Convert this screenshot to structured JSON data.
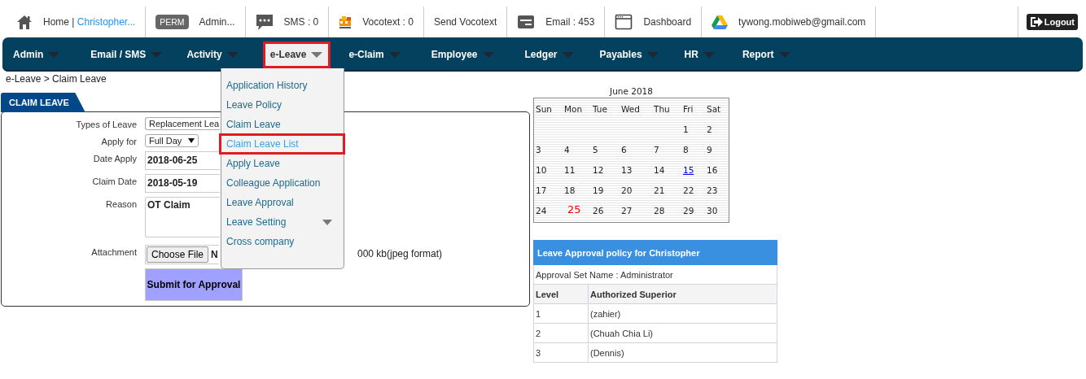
{
  "top_bar": {
    "items": [
      {
        "kind": "home",
        "label": "Home |",
        "link": "Christopher..."
      },
      {
        "kind": "perm",
        "badge": "PERM",
        "label": "Admin..."
      },
      {
        "kind": "sms",
        "label": "SMS : 0"
      },
      {
        "kind": "vocotext",
        "label": "Vocotext : 0"
      },
      {
        "kind": "text",
        "label": "Send Vocotext"
      },
      {
        "kind": "email",
        "label": "Email : 453"
      },
      {
        "kind": "dashboard",
        "label": "Dashboard"
      },
      {
        "kind": "drive",
        "label": "tywong.mobiweb@gmail.com"
      }
    ],
    "logout": "Logout"
  },
  "nav": {
    "items": [
      {
        "label": "Admin",
        "selected": false
      },
      {
        "label": "Email / SMS",
        "selected": false
      },
      {
        "label": "Activity",
        "selected": false
      },
      {
        "label": "e-Leave",
        "selected": true
      },
      {
        "label": "e-Claim",
        "selected": false
      },
      {
        "label": "Employee",
        "selected": false
      },
      {
        "label": "Ledger",
        "selected": false
      },
      {
        "label": "Payables",
        "selected": false
      },
      {
        "label": "HR",
        "selected": false
      },
      {
        "label": "Report",
        "selected": false
      }
    ]
  },
  "dropdown": {
    "items": [
      {
        "label": "Application History",
        "selected": false,
        "submenu": false
      },
      {
        "label": "Leave Policy",
        "selected": false,
        "submenu": false
      },
      {
        "label": "Claim Leave",
        "selected": false,
        "submenu": false
      },
      {
        "label": "Claim Leave List",
        "selected": true,
        "submenu": false
      },
      {
        "label": "Apply Leave",
        "selected": false,
        "submenu": false
      },
      {
        "label": "Colleague Application",
        "selected": false,
        "submenu": false
      },
      {
        "label": "Leave Approval",
        "selected": false,
        "submenu": false
      },
      {
        "label": "Leave Setting",
        "selected": false,
        "submenu": true
      },
      {
        "label": "Cross company",
        "selected": false,
        "submenu": false
      }
    ]
  },
  "breadcrumb": "e-Leave > Claim Leave",
  "form": {
    "tab": "CLAIM LEAVE",
    "fields": [
      {
        "kind": "select",
        "label": "Types of Leave",
        "value": "Replacement Lea"
      },
      {
        "kind": "dropdown",
        "label": "Apply for",
        "value": "Full Day"
      },
      {
        "kind": "input",
        "label": "Date Apply",
        "value": "2018-06-25"
      },
      {
        "kind": "input",
        "label": "Claim Date",
        "value": "2018-05-19"
      },
      {
        "kind": "textarea",
        "label": "Reason",
        "value": "OT Claim"
      },
      {
        "kind": "file",
        "label": "Attachment",
        "button": "Choose File",
        "value": "N",
        "note": "000 kb(jpeg format)"
      }
    ],
    "submit": "Submit for Approval"
  },
  "calendar": {
    "title": "June 2018",
    "weekdays": [
      "Sun",
      "Mon",
      "Tue",
      "Wed",
      "Thu",
      "Fri",
      "Sat"
    ],
    "weeks": [
      [
        {
          "text": "1",
          "kind": "plain"
        },
        {
          "text": "2",
          "kind": "plain"
        }
      ],
      [
        {
          "text": "3",
          "kind": "plain"
        },
        {
          "text": "4",
          "kind": "plain"
        },
        {
          "text": "5",
          "kind": "plain"
        },
        {
          "text": "6",
          "kind": "plain"
        },
        {
          "text": "7",
          "kind": "plain"
        },
        {
          "text": "8",
          "kind": "plain"
        },
        {
          "text": "9",
          "kind": "plain"
        }
      ],
      [
        {
          "text": "10",
          "kind": "plain"
        },
        {
          "text": "11",
          "kind": "plain"
        },
        {
          "text": "12",
          "kind": "plain"
        },
        {
          "text": "13",
          "kind": "plain"
        },
        {
          "text": "14",
          "kind": "plain"
        },
        {
          "text": "15",
          "kind": "link"
        },
        {
          "text": "16",
          "kind": "plain"
        }
      ],
      [
        {
          "text": "17",
          "kind": "plain"
        },
        {
          "text": "18",
          "kind": "plain"
        },
        {
          "text": "19",
          "kind": "plain"
        },
        {
          "text": "20",
          "kind": "plain"
        },
        {
          "text": "21",
          "kind": "plain"
        },
        {
          "text": "22",
          "kind": "plain"
        },
        {
          "text": "23",
          "kind": "plain"
        }
      ],
      [
        {
          "text": "24",
          "kind": "plain"
        },
        {
          "text": "25",
          "kind": "today"
        },
        {
          "text": "26",
          "kind": "plain"
        },
        {
          "text": "27",
          "kind": "plain"
        },
        {
          "text": "28",
          "kind": "plain"
        },
        {
          "text": "29",
          "kind": "plain"
        },
        {
          "text": "30",
          "kind": "plain"
        }
      ]
    ]
  },
  "policy": {
    "title": "Leave Approval policy for Christopher",
    "set_name": "Approval Set Name : Administrator",
    "columns": [
      "Level",
      "Authorized Superior"
    ],
    "rows": [
      [
        "1",
        "(zahier)"
      ],
      [
        "2",
        "(Chuah Chia Li)"
      ],
      [
        "3",
        "(Dennis)"
      ]
    ]
  }
}
